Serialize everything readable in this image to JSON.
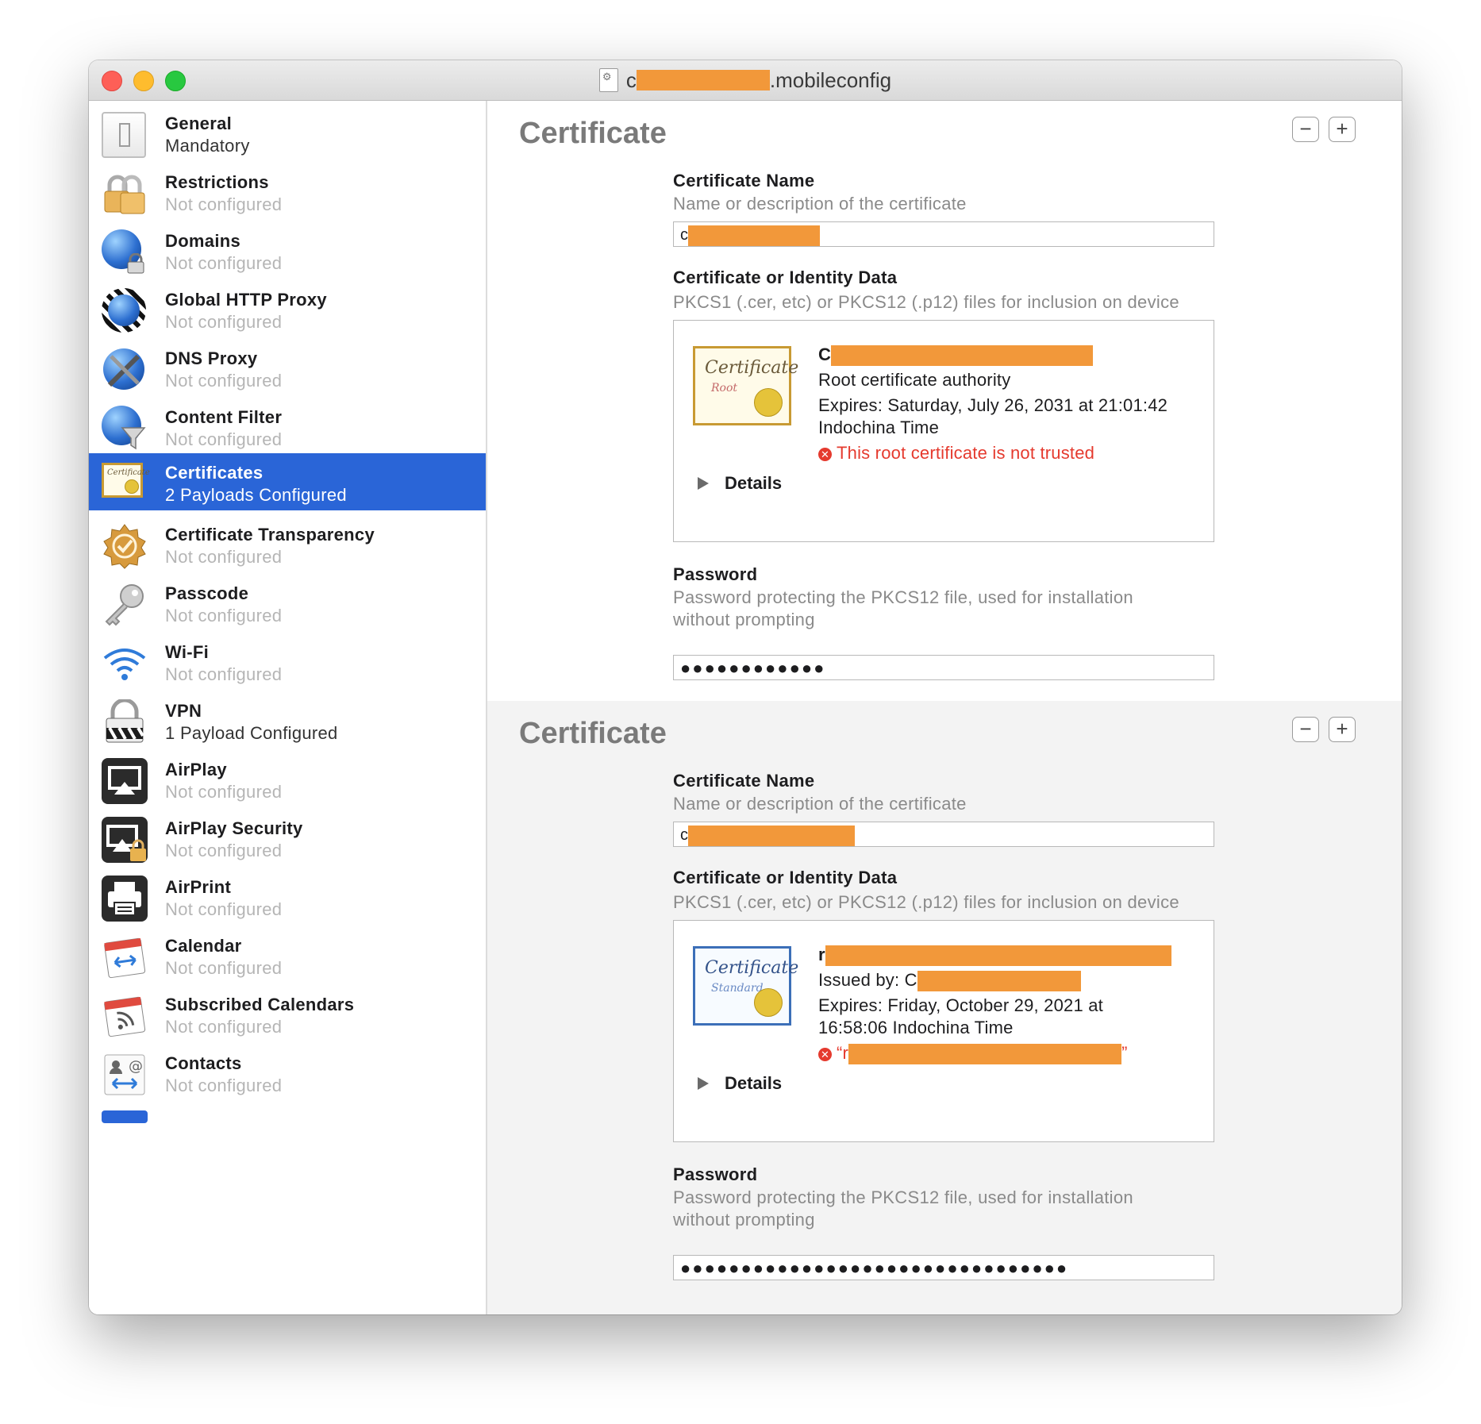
{
  "window": {
    "title_prefix": "c",
    "title_suffix": ".mobileconfig"
  },
  "sidebar": {
    "items": [
      {
        "title": "General",
        "subtitle": "Mandatory",
        "icon": "switch-icon"
      },
      {
        "title": "Restrictions",
        "subtitle": "Not configured",
        "icon": "padlock-icon"
      },
      {
        "title": "Domains",
        "subtitle": "Not configured",
        "icon": "globe-lock-icon"
      },
      {
        "title": "Global HTTP Proxy",
        "subtitle": "Not configured",
        "icon": "globe-proxy-icon"
      },
      {
        "title": "DNS Proxy",
        "subtitle": "Not configured",
        "icon": "globe-tools-icon"
      },
      {
        "title": "Content Filter",
        "subtitle": "Not configured",
        "icon": "globe-filter-icon"
      },
      {
        "title": "Certificates",
        "subtitle": "2 Payloads Configured",
        "icon": "certificate-icon",
        "selected": true
      },
      {
        "title": "Certificate Transparency",
        "subtitle": "Not configured",
        "icon": "badge-check-icon"
      },
      {
        "title": "Passcode",
        "subtitle": "Not configured",
        "icon": "key-icon"
      },
      {
        "title": "Wi-Fi",
        "subtitle": "Not configured",
        "icon": "wifi-icon"
      },
      {
        "title": "VPN",
        "subtitle": "1 Payload Configured",
        "icon": "vpn-lock-icon"
      },
      {
        "title": "AirPlay",
        "subtitle": "Not configured",
        "icon": "airplay-icon"
      },
      {
        "title": "AirPlay Security",
        "subtitle": "Not configured",
        "icon": "airplay-lock-icon"
      },
      {
        "title": "AirPrint",
        "subtitle": "Not configured",
        "icon": "printer-icon"
      },
      {
        "title": "Calendar",
        "subtitle": "Not configured",
        "icon": "calendar-sync-icon"
      },
      {
        "title": "Subscribed Calendars",
        "subtitle": "Not configured",
        "icon": "calendar-rss-icon"
      },
      {
        "title": "Contacts",
        "subtitle": "Not configured",
        "icon": "contacts-icon"
      }
    ]
  },
  "certificates": [
    {
      "section_title": "Certificate",
      "remove_label": "−",
      "add_label": "+",
      "name_label": "Certificate Name",
      "name_desc": "Name or description of the certificate",
      "name_value_prefix": "c",
      "data_label": "Certificate or Identity Data",
      "data_desc": "PKCS1 (.cer, etc) or PKCS12 (.p12) files for inclusion on device",
      "cert_icon_title": "Certificate",
      "cert_icon_sub": "Root",
      "cert_name_prefix": "C",
      "line1": "Root certificate authority",
      "line2": "Expires: Saturday, July 26, 2031 at 21:01:42",
      "line3": "Indochina Time",
      "error": "This root certificate is not trusted",
      "details_label": "Details",
      "password_label": "Password",
      "password_desc": "Password protecting the PKCS12 file, used for installation without prompting",
      "password_value": "●●●●●●●●●●●●"
    },
    {
      "section_title": "Certificate",
      "remove_label": "−",
      "add_label": "+",
      "name_label": "Certificate Name",
      "name_desc": "Name or description of the certificate",
      "name_value_prefix": "c",
      "data_label": "Certificate or Identity Data",
      "data_desc": "PKCS1 (.cer, etc) or PKCS12 (.p12) files for inclusion on device",
      "cert_icon_title": "Certificate",
      "cert_icon_sub": "Standard",
      "cert_name_prefix": "r",
      "line1": "Issued by: C",
      "line2": "Expires: Friday, October 29, 2021 at",
      "line3": "16:58:06 Indochina Time",
      "error_open": "“r",
      "error_close": "”",
      "details_label": "Details",
      "password_label": "Password",
      "password_desc": "Password protecting the PKCS12 file, used for installation without prompting",
      "password_value": "●●●●●●●●●●●●●●●●●●●●●●●●●●●●●●●●"
    }
  ]
}
